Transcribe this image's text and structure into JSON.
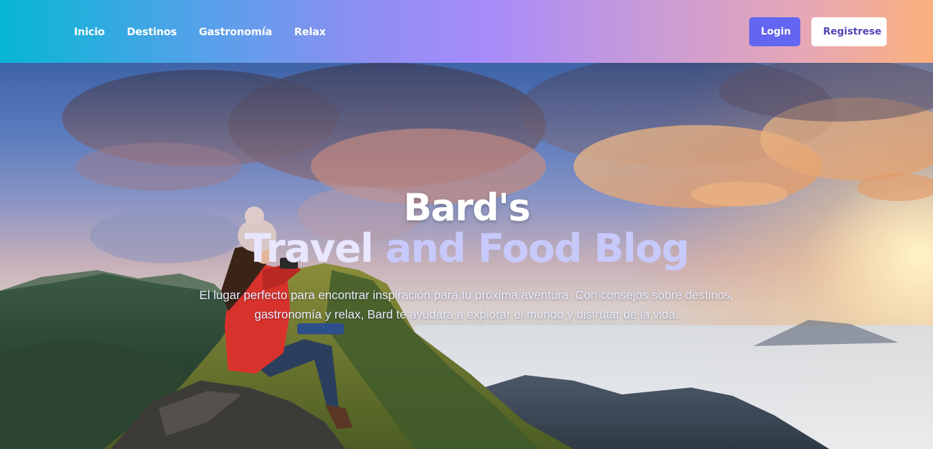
{
  "nav": {
    "links": [
      "Inicio",
      "Destinos",
      "Gastronomía",
      "Relax"
    ],
    "login_label": "Login",
    "register_label": "Registrese"
  },
  "hero": {
    "title_line1": "Bard's",
    "title_line2_part1": "Travel ",
    "title_line2_part2": "and Food Blog",
    "description": "El lugar perfecto para encontrar inspiración para tu próxima aventura. Con consejos sobre destinos, gastronomía y relax, Bard te ayudará a explorar el mundo y disfrutar de la vida."
  },
  "colors": {
    "login_button": "#6366f1",
    "register_text": "#4f46b5",
    "title_accent": "#c7c9fb"
  }
}
